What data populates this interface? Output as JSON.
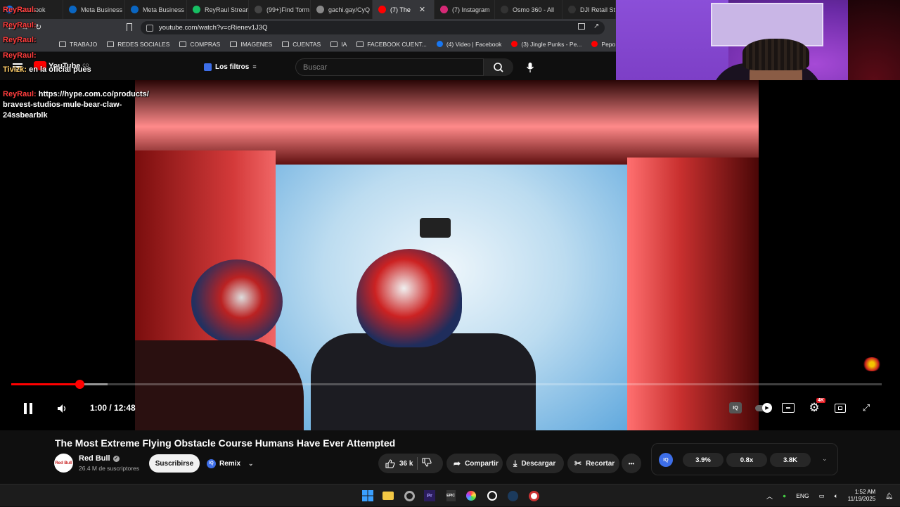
{
  "browser": {
    "tabs": [
      {
        "label": "Facebook"
      },
      {
        "label": "Meta Business"
      },
      {
        "label": "Meta Business"
      },
      {
        "label": "ReyRaul Stream"
      },
      {
        "label": "(99+)Find 'form"
      },
      {
        "label": "gachi.gay/CyQ"
      },
      {
        "label": "(7) The",
        "active": true
      },
      {
        "label": "(7) Instagram"
      },
      {
        "label": "Osmo 360 - All"
      },
      {
        "label": "DJI Retail Store"
      }
    ],
    "close_tab_glyph": "✕",
    "url": "youtube.com/watch?v=cRienev1J3Q",
    "bookmarks": [
      {
        "label": "TRABAJO",
        "icon": "folder-icon"
      },
      {
        "label": "REDES SOCIALES",
        "icon": "folder-icon"
      },
      {
        "label": "COMPRAS",
        "icon": "folder-icon"
      },
      {
        "label": "IMAGENES",
        "icon": "folder-icon"
      },
      {
        "label": "CUENTAS",
        "icon": "folder-icon"
      },
      {
        "label": "IA",
        "icon": "folder-icon"
      },
      {
        "label": "FACEBOOK CUENT...",
        "icon": "folder-icon"
      },
      {
        "label": "(4) Video | Facebook",
        "icon": "facebook-icon"
      },
      {
        "label": "(3) Jingle Punks - Pe...",
        "icon": "youtube-icon"
      },
      {
        "label": "Pepo x @kazu.oficia...",
        "icon": "youtube-icon"
      }
    ]
  },
  "youtube": {
    "logo_text": "YouTube",
    "logo_suffix": "CO",
    "filters_label": "Los filtros",
    "search_placeholder": "Buscar"
  },
  "overlay_chat": [
    {
      "name": "ReyRaul",
      "message": ""
    },
    {
      "name": "ReyRaul",
      "message": ""
    },
    {
      "name": "ReyRaul",
      "message": ""
    },
    {
      "name": "ReyRaul",
      "message": ""
    },
    {
      "name": "Tivizk",
      "message": "en la oficial pues"
    },
    {
      "name": "ReyRaul",
      "message": "https://hype.com.co/products/"
    },
    {
      "message": "bravest-studios-mule-bear-claw-"
    },
    {
      "message": "24ssbearblk"
    }
  ],
  "player": {
    "current_time": "1:00",
    "duration": "12:48",
    "time_display": "1:00 / 12:48",
    "progress": 0.078,
    "buffered": 0.111,
    "quality_badge": "4K",
    "accent": "#ff0000"
  },
  "video_info": {
    "title": "The Most Extreme Flying Obstacle Course Humans Have Ever Attempted",
    "channel": "Red Bull",
    "avatar_text": "Red Bull",
    "verified_glyph": "✓",
    "subscribers": "26.4 M de suscriptores",
    "subscribe_label": "Suscribirse",
    "remix_label": "Remix",
    "iq_label": "IQ",
    "like_count": "36 k",
    "share_label": "Compartir",
    "download_label": "Descargar",
    "clip_label": "Recortar",
    "more_glyph": "•••"
  },
  "stats_panel": {
    "iq_label": "IQ",
    "values": [
      "3.9%",
      "0.8x",
      "3.8K"
    ],
    "chevron": "⌄"
  },
  "taskbar": {
    "language": "ENG",
    "time": "1:52 AM",
    "date": "11/19/2025"
  }
}
